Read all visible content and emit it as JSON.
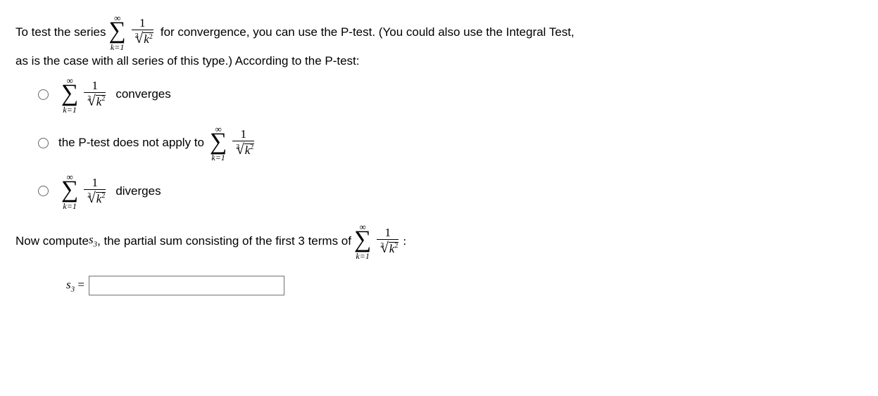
{
  "intro1a": "To test the series",
  "intro1b": "for convergence, you can use the P-test. (You could also use the Integral Test,",
  "intro2": "as is the case with all series of this type.) According to the P-test:",
  "sigma": {
    "top": "∞",
    "symbol": "∑",
    "bottom": "k=1"
  },
  "frac": {
    "num": "1",
    "root_index": "3",
    "radical": "√",
    "radicand_var": "k",
    "radicand_exp": "2"
  },
  "options": {
    "opt1_suffix": "converges",
    "opt2_prefix": "the P-test does not apply to",
    "opt3_suffix": "diverges"
  },
  "compute1a": "Now compute ",
  "compute_s": "s",
  "compute_sub": "3",
  "compute1b": ", the partial sum consisting of the first 3 terms of ",
  "s3": {
    "s": "s",
    "sub": "3",
    "eq": " ="
  },
  "input_value": ""
}
